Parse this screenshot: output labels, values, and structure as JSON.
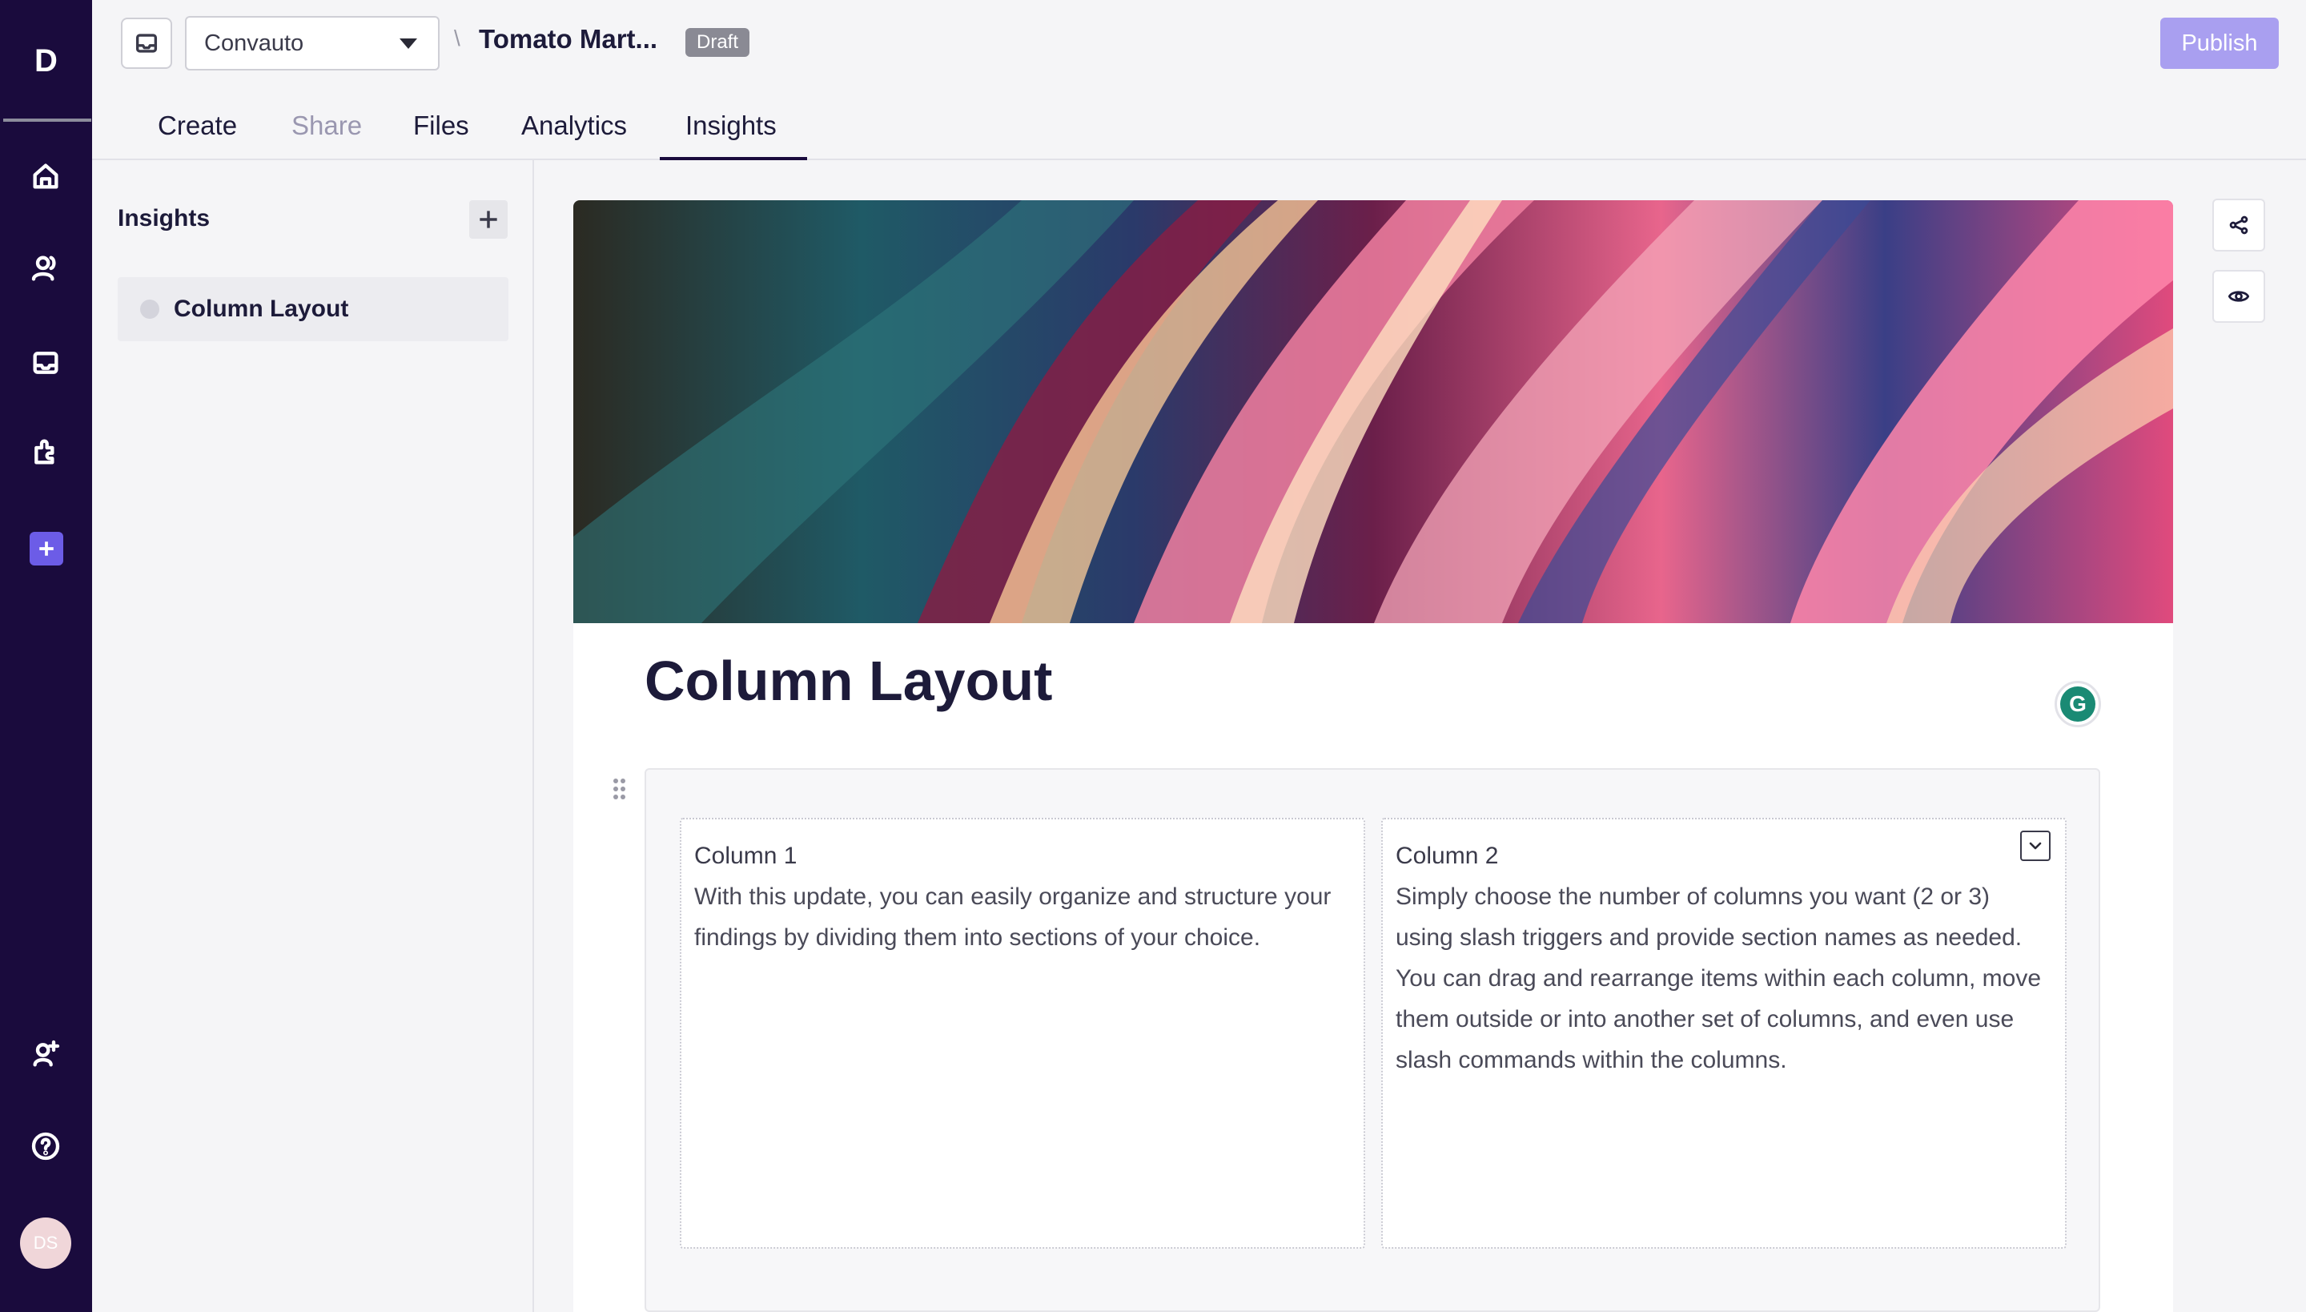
{
  "rail": {
    "logo": "D",
    "avatar_initials": "DS",
    "icons": [
      "home-icon",
      "users-icon",
      "inbox-icon",
      "integrations-icon",
      "add-icon",
      "invite-user-icon",
      "help-icon"
    ]
  },
  "header": {
    "workspace": "Convauto",
    "crumb_separator": "\\",
    "project_title": "Tomato Mart...",
    "status_badge": "Draft",
    "publish_label": "Publish",
    "tabs": [
      {
        "label": "Create"
      },
      {
        "label": "Share"
      },
      {
        "label": "Files"
      },
      {
        "label": "Analytics"
      },
      {
        "label": "Insights"
      }
    ]
  },
  "insights_panel": {
    "title": "Insights",
    "items": [
      {
        "label": "Column Layout"
      }
    ]
  },
  "doc": {
    "title": "Column Layout",
    "columns": [
      {
        "heading": "Column 1",
        "body": "With this update, you can easily organize and structure your findings by dividing them into sections of your choice."
      },
      {
        "heading": "Column 2",
        "body": "Simply choose the number of columns you want (2 or 3) using slash triggers and provide section names as needed. You can drag and rearrange items within each column, move them outside or into another set of columns, and even use slash commands within the columns."
      }
    ]
  },
  "colors": {
    "rail_bg": "#1a0b3d",
    "accent": "#6c5ce7",
    "publish_bg": "#a99ff0",
    "draft_badge": "#8a8a94"
  }
}
